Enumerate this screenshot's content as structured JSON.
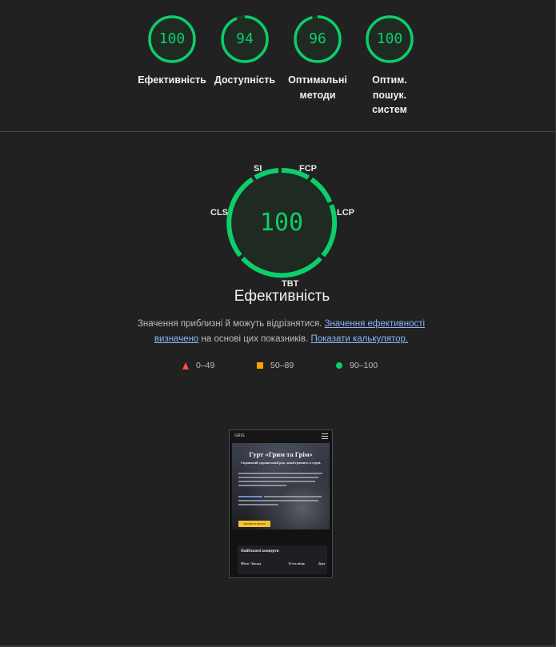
{
  "summary": {
    "gauges": [
      {
        "score": "100",
        "label": "Ефективність"
      },
      {
        "score": "94",
        "label": "Доступність"
      },
      {
        "score": "96",
        "label": "Оптимальні методи"
      },
      {
        "score": "100",
        "label": "Оптим. пошук. систем"
      }
    ]
  },
  "performance": {
    "score": "100",
    "title": "Ефективність",
    "metrics": {
      "si": "SI",
      "fcp": "FCP",
      "lcp": "LCP",
      "tbt": "TBT",
      "cls": "CLS"
    },
    "note_prefix": "Значення приблизні й можуть відрізнятися. ",
    "note_link": "Значення ефективності визначено",
    "note_middle": " на основі цих показників. ",
    "calculator_link": "Показати калькулятор."
  },
  "legend": {
    "fail": "0–49",
    "average": "50–89",
    "pass": "90–100"
  },
  "colors": {
    "pass": "#0cce6b",
    "average": "#ffa400",
    "fail": "#ff4e42",
    "link": "#8ab4f8",
    "background": "#212121"
  },
  "thumbnail": {
    "logo": "GRIG",
    "title": "Гурт «Грим та Грім»",
    "subtitle": "Справжній український рок, який гримить в серці.",
    "button": "Замовити виступ",
    "card_title": "Найближчі концерти",
    "columns": [
      "Місто / Заклад",
      "К-сть місць",
      "Дата"
    ]
  }
}
